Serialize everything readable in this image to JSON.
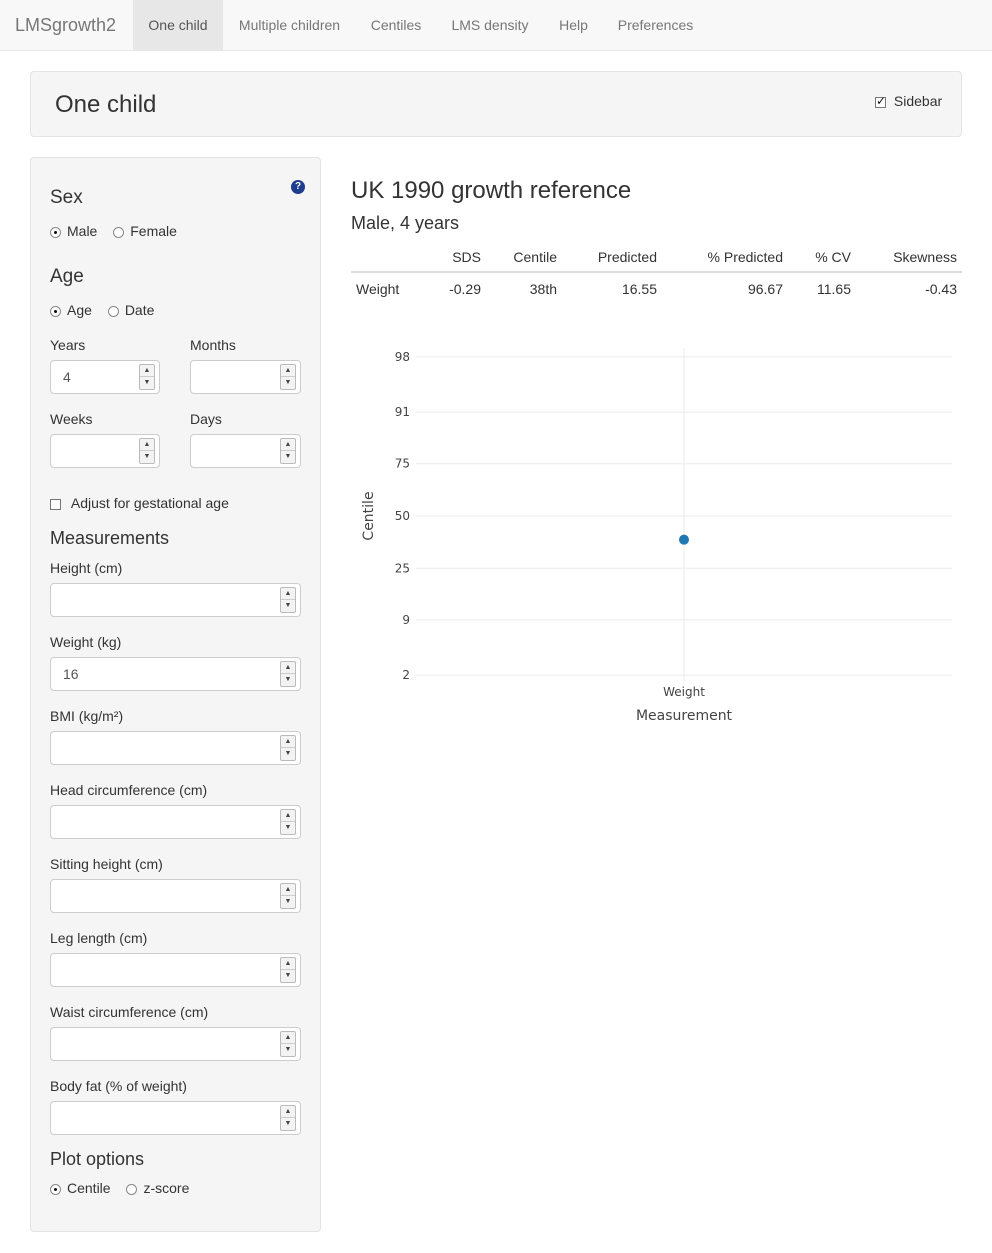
{
  "navbar": {
    "brand": "LMSgrowth2",
    "tabs": [
      {
        "label": "One child",
        "active": true
      },
      {
        "label": "Multiple children",
        "active": false
      },
      {
        "label": "Centiles",
        "active": false
      },
      {
        "label": "LMS density",
        "active": false
      },
      {
        "label": "Help",
        "active": false
      },
      {
        "label": "Preferences",
        "active": false
      }
    ]
  },
  "title_panel": {
    "title": "One child",
    "sidebar_label": "Sidebar",
    "sidebar_checked": true
  },
  "sidebar": {
    "sex": {
      "heading": "Sex",
      "help_icon": "question-circle-icon",
      "options": [
        "Male",
        "Female"
      ],
      "selected": "Male"
    },
    "age": {
      "heading": "Age",
      "options": [
        "Age",
        "Date"
      ],
      "selected": "Age",
      "years_label": "Years",
      "years_value": "4",
      "months_label": "Months",
      "months_value": "",
      "weeks_label": "Weeks",
      "weeks_value": "",
      "days_label": "Days",
      "days_value": ""
    },
    "gestational": {
      "label": "Adjust for gestational age",
      "checked": false
    },
    "measurements": {
      "heading": "Measurements",
      "fields": [
        {
          "label": "Height (cm)",
          "value": ""
        },
        {
          "label": "Weight (kg)",
          "value": "16"
        },
        {
          "label": "BMI (kg/m²)",
          "value": ""
        },
        {
          "label": "Head circumference (cm)",
          "value": ""
        },
        {
          "label": "Sitting height (cm)",
          "value": ""
        },
        {
          "label": "Leg length (cm)",
          "value": ""
        },
        {
          "label": "Waist circumference (cm)",
          "value": ""
        },
        {
          "label": "Body fat (% of weight)",
          "value": ""
        }
      ]
    },
    "plot_options": {
      "heading": "Plot options",
      "options": [
        "Centile",
        "z-score"
      ],
      "selected": "Centile"
    }
  },
  "main": {
    "title": "UK 1990 growth reference",
    "subtitle": "Male, 4 years",
    "table": {
      "headers": [
        "",
        "SDS",
        "Centile",
        "Predicted",
        "% Predicted",
        "% CV",
        "Skewness"
      ],
      "rows": [
        [
          "Weight",
          "-0.29",
          "38th",
          "16.55",
          "96.67",
          "11.65",
          "-0.43"
        ]
      ]
    }
  },
  "chart_data": {
    "type": "scatter",
    "categories": [
      "Weight"
    ],
    "values": [
      38
    ],
    "xlabel": "Measurement",
    "ylabel": "Centile",
    "y_ticks": [
      2,
      9,
      25,
      50,
      75,
      91,
      98
    ],
    "y_scale": "probit",
    "grid": true,
    "point_color": "#1f77b4"
  }
}
